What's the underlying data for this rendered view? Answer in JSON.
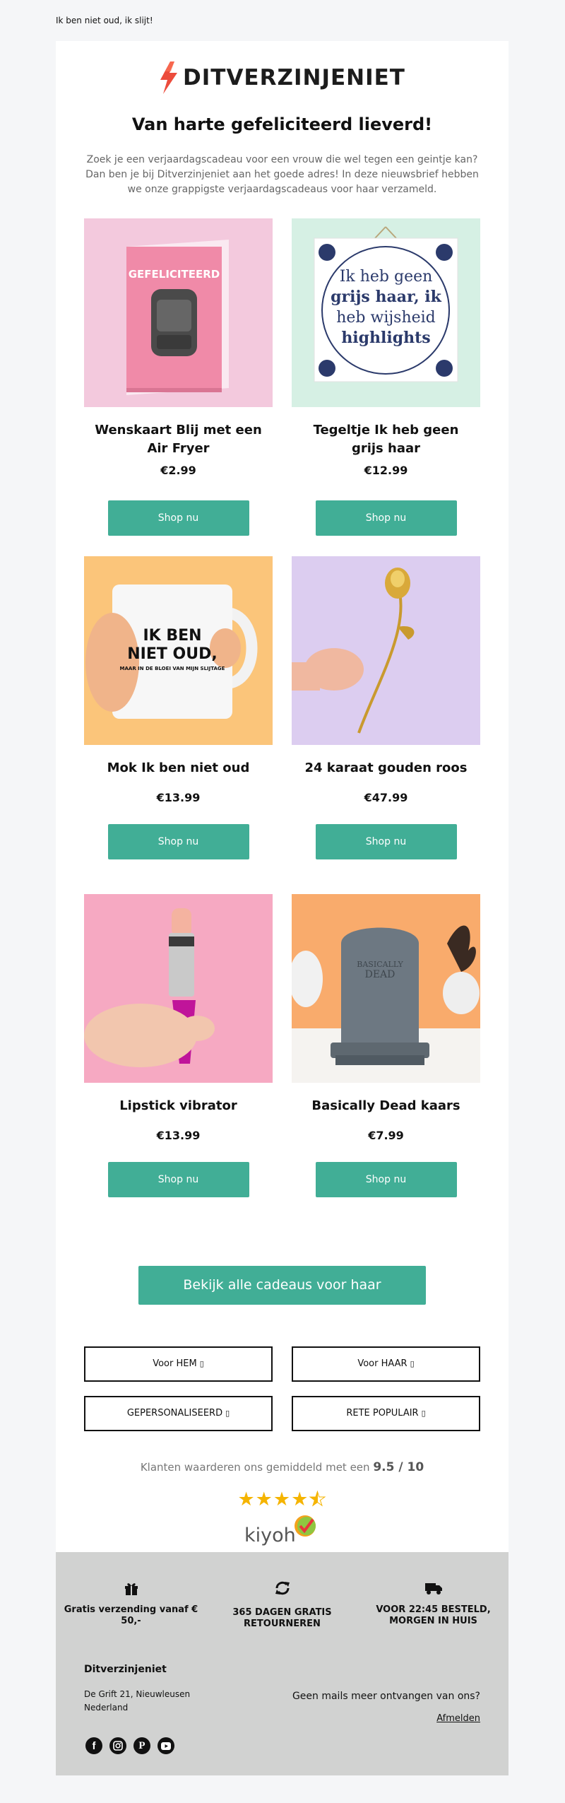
{
  "preheader": "Ik ben niet oud, ik slijt!",
  "brand": {
    "name": "DITVERZINJENIET",
    "accent": "#ec4c3c"
  },
  "headline": "Van harte gefeliciteerd lieverd!",
  "intro": "Zoek je een verjaardagscadeau voor een vrouw die wel tegen een geintje kan? Dan ben je bij Ditverzinjeniet aan het goede adres! In deze nieuwsbrief hebben we onze grappigste verjaardagscadeaus voor haar verzameld.",
  "products": [
    {
      "title": "Wenskaart Blij met een Air Fryer",
      "price": "€2.99",
      "cta": "Shop nu",
      "img_text": "GEFELICITEERD"
    },
    {
      "title": "Tegeltje Ik heb geen grijs haar",
      "price": "€12.99",
      "cta": "Shop nu",
      "img_lines": [
        "Ik heb geen",
        "grijs haar, ik",
        "heb wijsheid",
        "highlights"
      ]
    },
    {
      "title": "Mok Ik ben niet oud",
      "price": "€13.99",
      "cta": "Shop nu",
      "img_lines": [
        "IK BEN",
        "NIET OUD,",
        "MAAR IN DE BLOEI VAN MIJN SLIJTAGE"
      ]
    },
    {
      "title": "24 karaat gouden roos",
      "price": "€47.99",
      "cta": "Shop nu"
    },
    {
      "title": "Lipstick vibrator",
      "price": "€13.99",
      "cta": "Shop nu"
    },
    {
      "title": "Basically Dead kaars",
      "price": "€7.99",
      "cta": "Shop nu",
      "img_lines": [
        "BASICALLY",
        "DEAD"
      ]
    }
  ],
  "all_gifts_cta": "Bekijk alle cadeaus voor haar",
  "categories": [
    {
      "label": "Voor HEM",
      "icon": "arrow-icon"
    },
    {
      "label": "Voor HAAR",
      "icon": "arrow-icon"
    },
    {
      "label": "GEPERSONALISEERD",
      "icon": "arrow-icon"
    },
    {
      "label": "RETE POPULAIR",
      "icon": "arrow-icon"
    }
  ],
  "rating": {
    "prefix": "Klanten waarderen ons gemiddeld met een",
    "score": "9.5 / 10",
    "stars": 4.5,
    "provider": "kiyoh"
  },
  "usps": [
    {
      "icon": "gift-icon",
      "label": "Gratis verzending vanaf € 50,-"
    },
    {
      "icon": "refresh-icon",
      "label": "365 DAGEN GRATIS RETOURNEREN"
    },
    {
      "icon": "truck-icon",
      "label": "VOOR 22:45 BESTELD, MORGEN IN HUIS"
    }
  ],
  "footer": {
    "company": "Ditverzinjeniet",
    "address_line1": "De Grift 21, Nieuwleusen",
    "address_line2": "Nederland",
    "unsubscribe_question": "Geen mails meer ontvangen van ons?",
    "unsubscribe_link": "Afmelden",
    "socials": [
      "facebook-icon",
      "instagram-icon",
      "pinterest-icon",
      "youtube-icon"
    ]
  },
  "colors": {
    "primary_button": "#41ae96",
    "footer_bg": "#d1d2d1",
    "page_bg": "#f5f6f8",
    "star": "#f5b400"
  }
}
